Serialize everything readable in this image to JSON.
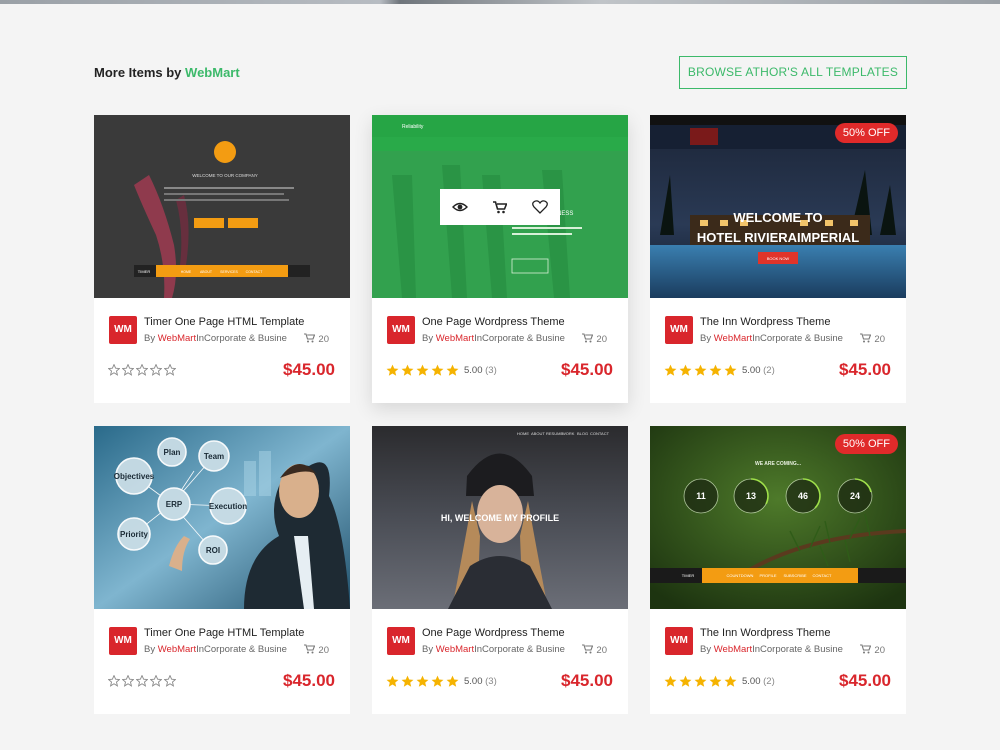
{
  "header": {
    "title_prefix": "More Items by",
    "title_brand": "WebMart",
    "browse_label": "BROWSE ATHOR'S ALL TEMPLATES"
  },
  "colors": {
    "accent": "#3cb96a",
    "price": "#d9262c",
    "star": "#f5b301",
    "badge": "#e02a2a"
  },
  "icons": {
    "view": "eye-icon",
    "cart": "cart-icon",
    "wishlist": "heart-icon",
    "sales": "cart-icon",
    "star": "star-icon"
  },
  "cards": [
    {
      "logo": "WM",
      "title": "Timer One Page HTML Template",
      "by": "By",
      "author": "WebMart",
      "category": "InCorporate & Busine",
      "sales": "20",
      "rating": 0,
      "rating_text": "",
      "rating_count": "",
      "price": "$45.00",
      "badge": "",
      "thumb_text": [
        "WELCOME TO OUR COMPANY",
        "TIMER",
        "HOME",
        "ABOUT",
        "SERVICES",
        "CONTACT"
      ]
    },
    {
      "logo": "WM",
      "title": "One Page Wordpress Theme",
      "by": "By",
      "author": "WebMart",
      "category": "InCorporate & Busine",
      "sales": "20",
      "rating": 5,
      "rating_text": "5.00",
      "rating_count": "(3)",
      "price": "$45.00",
      "badge": "",
      "thumb_text": [
        "Reliability",
        "NESS"
      ]
    },
    {
      "logo": "WM",
      "title": "The Inn Wordpress Theme",
      "by": "By",
      "author": "WebMart",
      "category": "InCorporate & Busine",
      "sales": "20",
      "rating": 5,
      "rating_text": "5.00",
      "rating_count": "(2)",
      "price": "$45.00",
      "badge": "50% OFF",
      "thumb_text": [
        "WELCOME TO",
        "HOTEL RIVIERAIMPERIAL",
        "BOOK NOW"
      ]
    },
    {
      "logo": "WM",
      "title": "Timer One Page HTML Template",
      "by": "By",
      "author": "WebMart",
      "category": "InCorporate & Busine",
      "sales": "20",
      "rating": 0,
      "rating_text": "",
      "rating_count": "",
      "price": "$45.00",
      "badge": "",
      "thumb_text": [
        "Objectives",
        "Plan",
        "Team",
        "ERP",
        "Execution",
        "Priority",
        "ROI"
      ]
    },
    {
      "logo": "WM",
      "title": "One Page Wordpress Theme",
      "by": "By",
      "author": "WebMart",
      "category": "InCorporate & Busine",
      "sales": "20",
      "rating": 5,
      "rating_text": "5.00",
      "rating_count": "(3)",
      "price": "$45.00",
      "badge": "",
      "thumb_text": [
        "HI, WELCOME MY PROFILE",
        "HOME",
        "ABOUT",
        "RESUME",
        "WORK",
        "BLOG",
        "CONTACT"
      ]
    },
    {
      "logo": "WM",
      "title": "The Inn Wordpress Theme",
      "by": "By",
      "author": "WebMart",
      "category": "InCorporate & Busine",
      "sales": "20",
      "rating": 5,
      "rating_text": "5.00",
      "rating_count": "(2)",
      "price": "$45.00",
      "badge": "50% OFF",
      "thumb_text": [
        "WE ARE COMING...",
        "11",
        "13",
        "46",
        "24",
        "TIMER",
        "COUNTDOWN",
        "PROFILE",
        "SUBSCRIBE",
        "CONTACT"
      ]
    }
  ]
}
